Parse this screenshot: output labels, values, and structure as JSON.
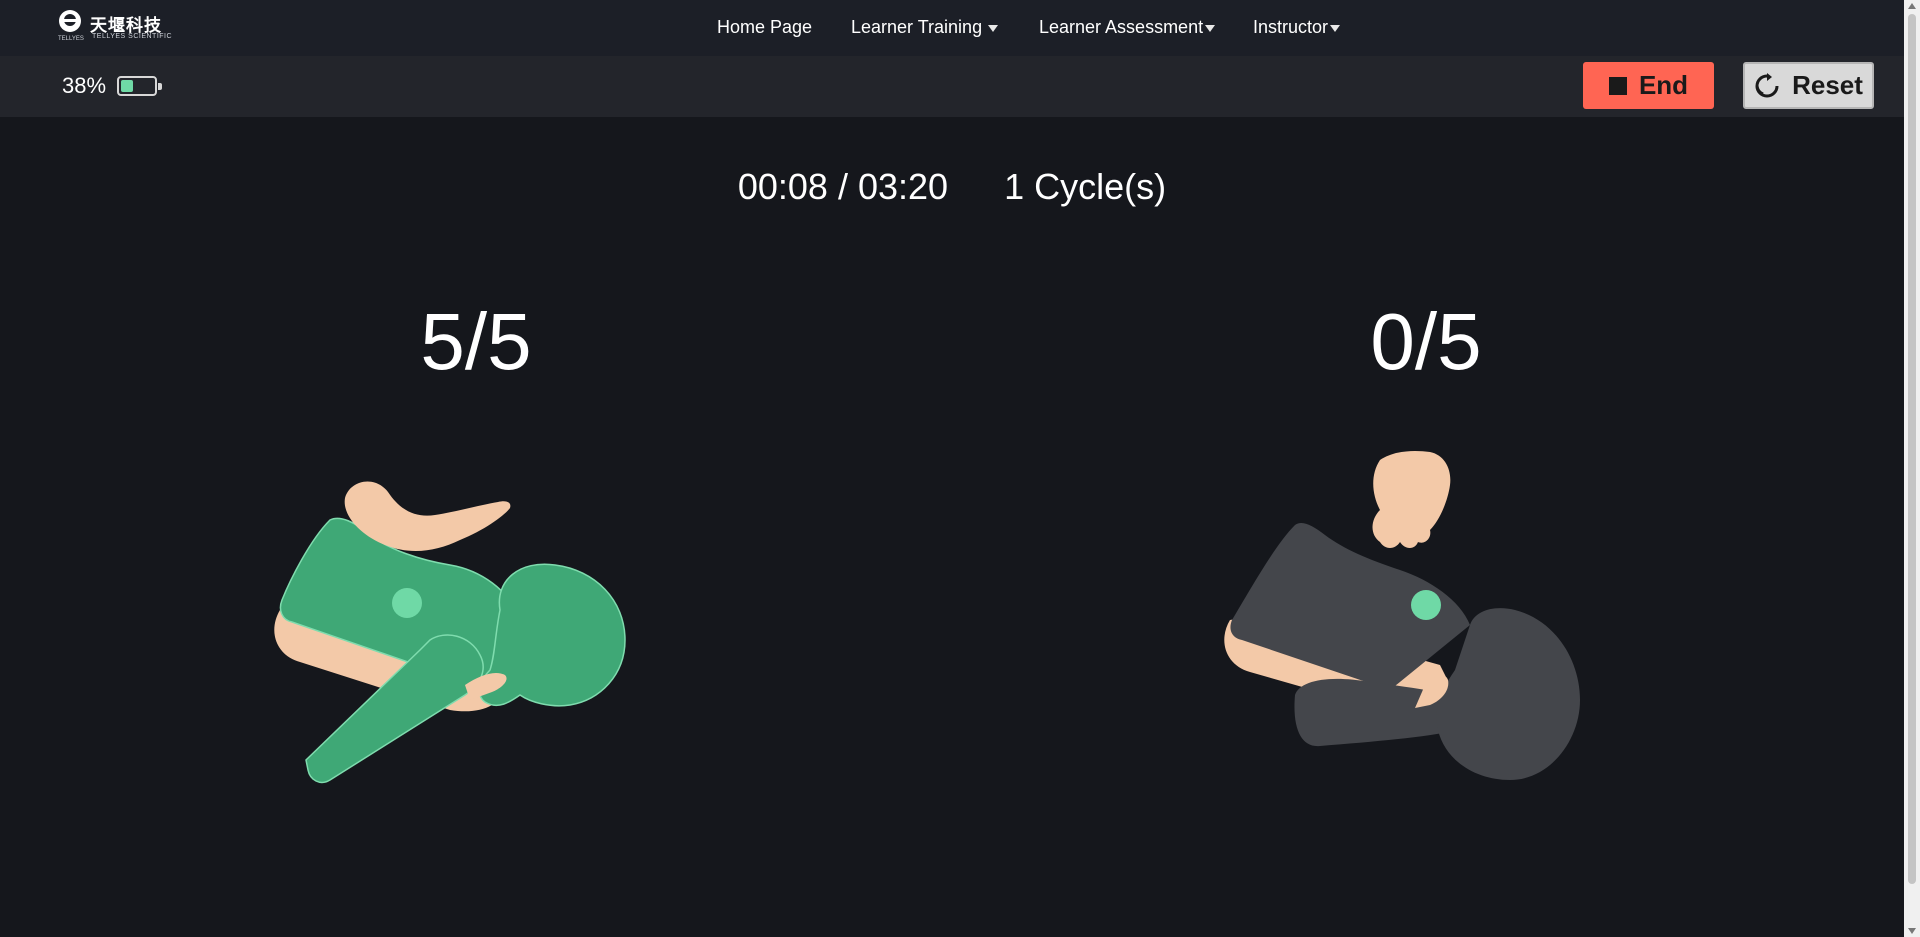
{
  "brand": {
    "name_cn": "天堰科技",
    "name_en": "TELLYES SCIENTIFIC",
    "mark_text": "TELLYES"
  },
  "nav": {
    "items": [
      {
        "label": "Home Page",
        "has_dropdown": false
      },
      {
        "label": "Learner Training",
        "has_dropdown": true
      },
      {
        "label": "Learner Assessment",
        "has_dropdown": true
      },
      {
        "label": "Instructor",
        "has_dropdown": true
      }
    ]
  },
  "status": {
    "battery_percent_label": "38%",
    "battery_level": 0.38,
    "battery_color": "#6fd9a6"
  },
  "controls": {
    "end_label": "End",
    "reset_label": "Reset",
    "end_color": "#ff6553",
    "reset_color": "#d9d9d9"
  },
  "session": {
    "elapsed": "00:08",
    "separator": "/",
    "total": "03:20",
    "cycles": "1 Cycle(s)"
  },
  "counters": {
    "left": {
      "label": "5/5",
      "figure_state": "complete",
      "figure_color": "#3fa876"
    },
    "right": {
      "label": "0/5",
      "figure_state": "pending",
      "figure_color": "#44464b"
    }
  },
  "marker_color": "#6fd9a6"
}
